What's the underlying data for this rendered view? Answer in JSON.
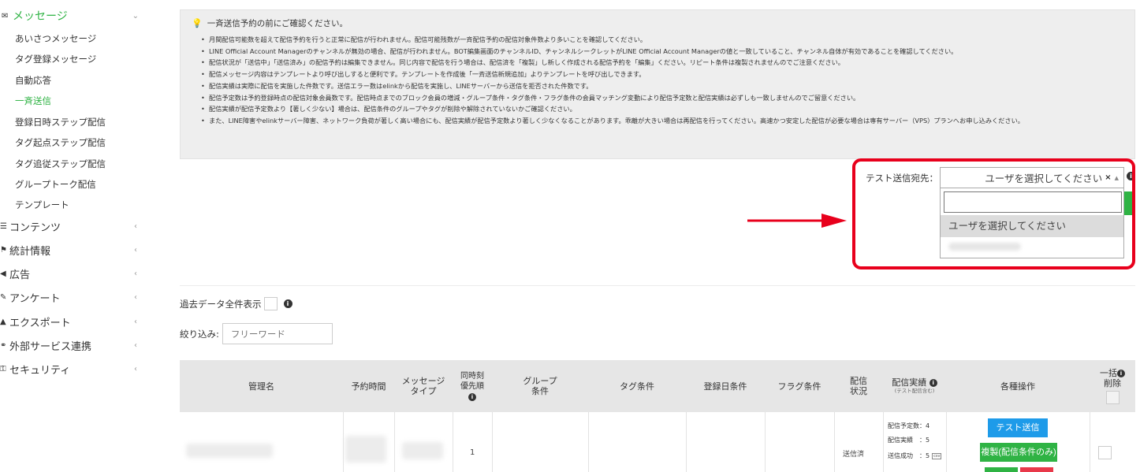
{
  "sidebar": {
    "message": {
      "label": "メッセージ",
      "icon": "envelope-icon"
    },
    "sub_items": [
      "あいさつメッセージ",
      "タグ登録メッセージ",
      "自動応答",
      "一斉送信",
      "登録日時ステップ配信",
      "タグ起点ステップ配信",
      "タグ追従ステップ配信",
      "グループトーク配信",
      "テンプレート"
    ],
    "active_sub_item": "一斉送信",
    "main_items": [
      {
        "label": "コンテンツ",
        "icon": "list-icon"
      },
      {
        "label": "統計情報",
        "icon": "flag-icon"
      },
      {
        "label": "広告",
        "icon": "megaphone-icon"
      },
      {
        "label": "アンケート",
        "icon": "pencil-icon"
      },
      {
        "label": "エクスポート",
        "icon": "export-icon"
      },
      {
        "label": "外部サービス連携",
        "icon": "link-icon"
      },
      {
        "label": "セキュリティ",
        "icon": "key-icon"
      }
    ],
    "accent_color": "#2fb344"
  },
  "notice": {
    "title": "一斉送信予約の前にご確認ください。",
    "items": [
      "月間配信可能数を超えて配信予約を行うと正常に配信が行われません。配信可能残数が一斉配信予約の配信対象件数より多いことを確認してください。",
      "LINE Official Account Managerのチャンネルが無効の場合、配信が行われません。BOT編集画面のチャンネルID、チャンネルシークレットがLINE Official Account Managerの値と一致していること、チャンネル自体が有効であることを確認してください。",
      "配信状況が「送信中」「送信済み」の配信予約は編集できません。同じ内容で配信を行う場合は、配信済を「複製」し新しく作成される配信予約を「編集」ください。リピート条件は複製されませんのでご注意ください。",
      "配信メッセージ内容はテンプレートより呼び出しすると便利です。テンプレートを作成後「一斉送信新規追加」よりテンプレートを呼び出しできます。",
      "配信実績は実際に配信を実施した件数です。送信エラー数はelinkから配信を実施し、LINEサーバーから送信を拒否された件数です。",
      "配信予定数は予約登録時点の配信対象会員数です。配信時点までのブロック会員の増減・グループ条件・タグ条件・フラグ条件の会員マッチング変動により配信予定数と配信実績は必ずしも一致しませんのでご留意ください。",
      "配信実績が配信予定数より【著しく少ない】場合は、配信条件のグループやタグが削除や解除されていないかご確認ください。"
    ],
    "last_item_cont": "また、LINE障害やelinkサーバー障害、ネットワーク負荷が著しく高い場合にも、配信実績が配信予定数より著しく少なくなることがあります。乖離が大きい場合は再配信を行ってください。高速かつ安定した配信が必要な場合は専有サーバー（VPS）プランへお申し込みください。"
  },
  "test_send": {
    "label": "テスト送信宛先：",
    "selected": "ユーザを選択してください",
    "clear_symbol": "×",
    "caret_symbol": "▲",
    "options": [
      "ユーザを選択してください"
    ]
  },
  "filters": {
    "past_data_label": "過去データ全件表示",
    "filter_label": "絞り込み:",
    "filter_placeholder": "フリーワード"
  },
  "table": {
    "headers": {
      "name": "管理名",
      "time": "予約時間",
      "msg_type_1": "メッセージ",
      "msg_type_2": "タイプ",
      "priority_1": "同時刻",
      "priority_2": "優先順",
      "group_1": "グループ",
      "group_2": "条件",
      "tag": "タグ条件",
      "reg_date": "登録日条件",
      "flag": "フラグ条件",
      "status_1": "配信",
      "status_2": "状況",
      "results": "配信実績",
      "results_note": "(テスト配信含む)",
      "ops": "各種操作",
      "bulk_1": "一括",
      "bulk_2": "削除"
    },
    "row": {
      "priority": "1",
      "status": "送信済",
      "planned": "配信予定数：4",
      "actual": "配信実績　：5",
      "success": "送信成功　：5",
      "csv": "csv",
      "test_button": "テスト送信",
      "copy_button": "複製(配信条件のみ)"
    }
  }
}
